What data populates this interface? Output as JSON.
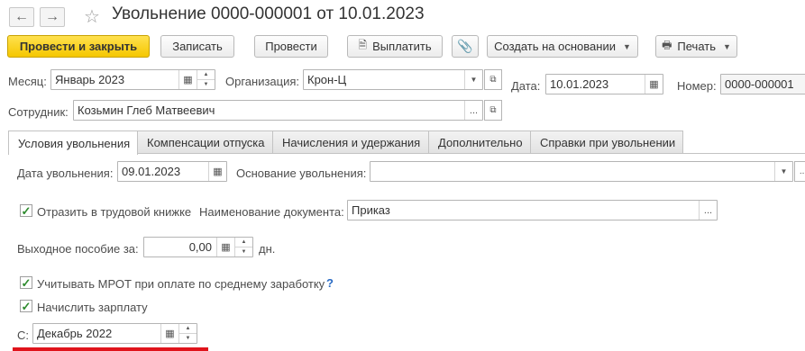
{
  "window": {
    "title": "Увольнение 0000-000001 от 10.01.2023"
  },
  "toolbar": {
    "post_close": "Провести и закрыть",
    "save": "Записать",
    "post": "Провести",
    "pay": "Выплатить",
    "create_based": "Создать на основании",
    "print": "Печать"
  },
  "header": {
    "month_label": "Месяц:",
    "month_value": "Январь 2023",
    "org_label": "Организация:",
    "org_value": "Крон-Ц",
    "date_label": "Дата:",
    "date_value": "10.01.2023",
    "number_label": "Номер:",
    "number_value": "0000-000001",
    "employee_label": "Сотрудник:",
    "employee_value": "Козьмин Глеб Матвеевич"
  },
  "tabs": [
    {
      "label": "Условия увольнения"
    },
    {
      "label": "Компенсации отпуска"
    },
    {
      "label": "Начисления и удержания"
    },
    {
      "label": "Дополнительно"
    },
    {
      "label": "Справки при увольнении"
    }
  ],
  "terms": {
    "dismissal_date_label": "Дата увольнения:",
    "dismissal_date_value": "09.01.2023",
    "reason_label": "Основание увольнения:",
    "reason_value": "",
    "workbook_label": "Отразить в трудовой книжке",
    "workbook_checked": true,
    "docname_label": "Наименование документа:",
    "docname_value": "Приказ",
    "severance_label": "Выходное пособие за:",
    "severance_value": "0,00",
    "severance_unit": "дн.",
    "mrot_label": "Учитывать МРОТ при оплате по среднему заработку",
    "mrot_checked": true,
    "mrot_help": "?",
    "accrue_label": "Начислить зарплату",
    "accrue_checked": true,
    "from_label": "С:",
    "from_value": "Декабрь 2022"
  },
  "colors": {
    "primary": "#f5c700",
    "check": "#2e8b2e",
    "help": "#2a6bc4",
    "highlight": "#e0131b"
  }
}
